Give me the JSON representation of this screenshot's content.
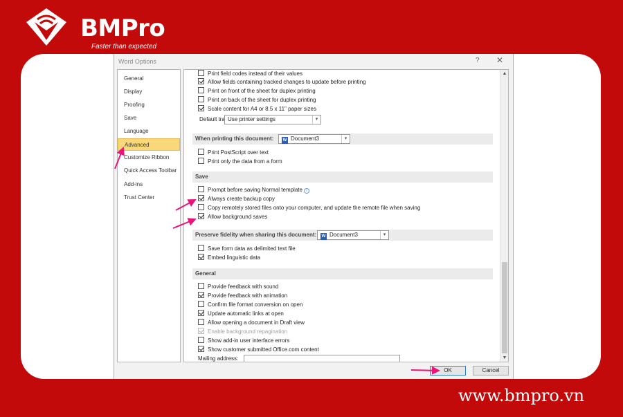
{
  "brand": {
    "name": "BMPro",
    "tagline": "Faster than expected",
    "website": "www.bmpro.vn"
  },
  "dialog": {
    "title": "Word Options",
    "help": "?",
    "close": "✕",
    "nav": [
      "General",
      "Display",
      "Proofing",
      "Save",
      "Language",
      "Advanced",
      "Customize Ribbon",
      "Quick Access Toolbar",
      "Add-ins",
      "Trust Center"
    ],
    "active_nav": "Advanced",
    "print": {
      "options": [
        {
          "label": "Print field codes instead of their values",
          "checked": false
        },
        {
          "label": "Allow fields containing tracked changes to update before printing",
          "checked": true
        },
        {
          "label": "Print on front of the sheet for duplex printing",
          "checked": false
        },
        {
          "label": "Print on back of the sheet for duplex printing",
          "checked": false
        },
        {
          "label": "Scale content for A4 or 8.5 x 11\" paper sizes",
          "checked": true
        }
      ],
      "default_tray_label": "Default tray:",
      "default_tray_value": "Use printer settings"
    },
    "when_printing": {
      "label": "When printing this document:",
      "document": "Document3",
      "options": [
        {
          "label": "Print PostScript over text",
          "checked": false
        },
        {
          "label": "Print only the data from a form",
          "checked": false
        }
      ]
    },
    "save": {
      "header": "Save",
      "options": [
        {
          "label": "Prompt before saving Normal template",
          "checked": false
        },
        {
          "label": "Always create backup copy",
          "checked": true
        },
        {
          "label": "Copy remotely stored files onto your computer, and update the remote file when saving",
          "checked": false
        },
        {
          "label": "Allow background saves",
          "checked": true
        }
      ]
    },
    "fidelity": {
      "label": "Preserve fidelity when sharing this document:",
      "document": "Document3",
      "options": [
        {
          "label": "Save form data as delimited text file",
          "checked": false
        },
        {
          "label": "Embed linguistic data",
          "checked": true
        }
      ]
    },
    "general": {
      "header": "General",
      "options": [
        {
          "label": "Provide feedback with sound",
          "checked": false,
          "disabled": false
        },
        {
          "label": "Provide feedback with animation",
          "checked": true,
          "disabled": false
        },
        {
          "label": "Confirm file format conversion on open",
          "checked": false,
          "disabled": false
        },
        {
          "label": "Update automatic links at open",
          "checked": true,
          "disabled": false
        },
        {
          "label": "Allow opening a document in Draft view",
          "checked": false,
          "disabled": false
        },
        {
          "label": "Enable background repagination",
          "checked": true,
          "disabled": true
        },
        {
          "label": "Show add-in user interface errors",
          "checked": false,
          "disabled": false
        },
        {
          "label": "Show customer submitted Office.com content",
          "checked": true,
          "disabled": false
        }
      ],
      "mailing_address_label": "Mailing address:"
    },
    "buttons": {
      "ok": "OK",
      "cancel": "Cancel"
    }
  },
  "colors": {
    "background": "#c20a0a",
    "highlight_arrow": "#e8157a",
    "active_nav": "#f8d87a"
  },
  "icons": [
    "logo-icon",
    "info-icon",
    "document-icon",
    "chevron-down-icon",
    "arrow-up-icon",
    "arrow-down-icon"
  ]
}
